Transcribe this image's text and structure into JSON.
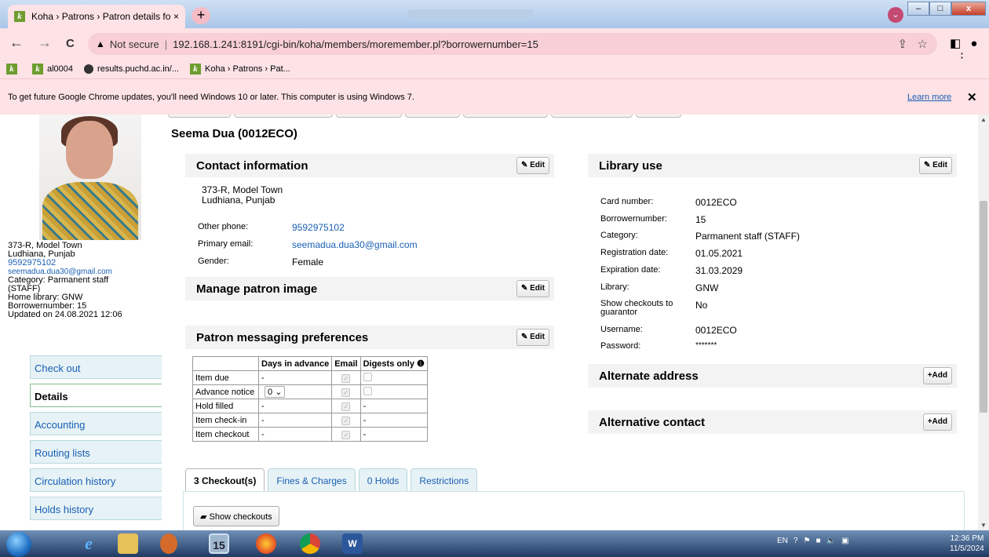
{
  "browser": {
    "tab_title": "Koha › Patrons › Patron details fo",
    "tab_close": "×",
    "new_tab": "+",
    "nav_back": "←",
    "nav_forward": "→",
    "nav_reload": "C",
    "security_label": "Not secure",
    "url": "192.168.1.241:8191/cgi-bin/koha/members/moremember.pl?borrowernumber=15",
    "bookmarks": [
      {
        "label": ""
      },
      {
        "label": "al0004"
      },
      {
        "label": "results.puchd.ac.in/..."
      },
      {
        "label": "Koha › Patrons › Pat..."
      }
    ],
    "infobar_message": "To get future Google Chrome updates, you'll need Windows 10 or later. This computer is using Windows 7.",
    "infobar_link": "Learn more",
    "infobar_close": "✕"
  },
  "sidebar": {
    "address_line1": "373-R, Model Town",
    "address_line2": "Ludhiana, Punjab",
    "phone": "9592975102",
    "email": "seemadua.dua30@gmail.com",
    "category": "Category: Parmanent staff (STAFF)",
    "home_library": "Home library: GNW",
    "borrowernumber": "Borrowernumber: 15",
    "updated": "Updated on 24.08.2021 12:06",
    "menu": [
      {
        "label": "Check out"
      },
      {
        "label": "Details"
      },
      {
        "label": "Accounting"
      },
      {
        "label": "Routing lists"
      },
      {
        "label": "Circulation history"
      },
      {
        "label": "Holds history"
      }
    ]
  },
  "patron": {
    "name": "Seema Dua (0012ECO)"
  },
  "contact": {
    "heading": "Contact information",
    "edit": "Edit",
    "address_line1": "373-R, Model Town",
    "address_line2": "Ludhiana, Punjab",
    "fields": [
      {
        "label": "Other phone:",
        "value": "9592975102"
      },
      {
        "label": "Primary email:",
        "value": "seemadua.dua30@gmail.com"
      },
      {
        "label": "Gender:",
        "value": "Female"
      }
    ]
  },
  "manage_image": {
    "heading": "Manage patron image",
    "edit": "Edit"
  },
  "messaging": {
    "heading": "Patron messaging preferences",
    "edit": "Edit",
    "columns": [
      "",
      "Days in advance",
      "Email",
      "Digests only"
    ],
    "rows": [
      {
        "name": "Item due",
        "days": "-",
        "digest": ""
      },
      {
        "name": "Advance notice",
        "days": "0",
        "digest": ""
      },
      {
        "name": "Hold filled",
        "days": "-",
        "digest": "-"
      },
      {
        "name": "Item check-in",
        "days": "-",
        "digest": "-"
      },
      {
        "name": "Item checkout",
        "days": "-",
        "digest": "-"
      }
    ]
  },
  "library_use": {
    "heading": "Library use",
    "edit": "Edit",
    "fields": [
      {
        "label": "Card number:",
        "value": "0012ECO"
      },
      {
        "label": "Borrowernumber:",
        "value": "15"
      },
      {
        "label": "Category:",
        "value": "Parmanent staff (STAFF)"
      },
      {
        "label": "Registration date:",
        "value": "01.05.2021"
      },
      {
        "label": "Expiration date:",
        "value": "31.03.2029"
      },
      {
        "label": "Library:",
        "value": "GNW"
      },
      {
        "label": "Show checkouts to guarantor",
        "value": "No"
      },
      {
        "label": "Username:",
        "value": "0012ECO"
      },
      {
        "label": "Password:",
        "value": "*******"
      }
    ]
  },
  "alt_address": {
    "heading": "Alternate address",
    "add": "Add"
  },
  "alt_contact": {
    "heading": "Alternative contact",
    "add": "Add"
  },
  "tabs": [
    {
      "label": "3 Checkout(s)"
    },
    {
      "label": "Fines & Charges"
    },
    {
      "label": "0 Holds"
    },
    {
      "label": "Restrictions"
    }
  ],
  "show_checkouts": "Show checkouts",
  "taskbar": {
    "lang": "EN",
    "time": "12:36 PM",
    "date": "11/5/2024"
  }
}
